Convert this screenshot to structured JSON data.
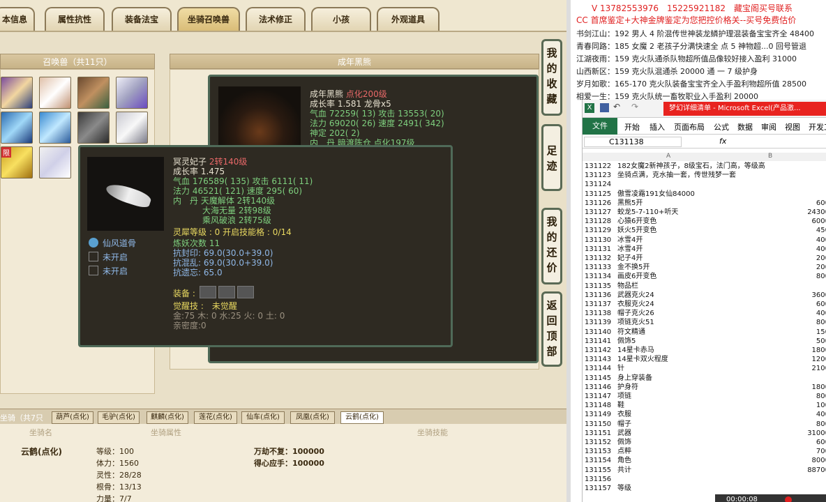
{
  "tabs": [
    {
      "label": "本信息"
    },
    {
      "label": "属性抗性"
    },
    {
      "label": "装备法宝"
    },
    {
      "label": "坐骑召唤兽"
    },
    {
      "label": "法术修正"
    },
    {
      "label": "小孩"
    },
    {
      "label": "外观道具"
    }
  ],
  "summon_panel": {
    "title": "召唤兽（共11只）",
    "badge": "限"
  },
  "adult_panel": {
    "title": "成年黑熊"
  },
  "side_buttons": [
    {
      "label": "我的收藏"
    },
    {
      "label": "足迹"
    },
    {
      "label": "我的还价"
    },
    {
      "label": "返回顶部"
    }
  ],
  "bear_card": {
    "name": "成年黑熊",
    "name_tag": "点化200级",
    "lines": [
      "成长率 1.581 龙骨x5",
      "气血 72259( 13) 攻击 13553( 20)",
      "法力 69020( 26) 速度 2491( 342)",
      "神定 202( 2)",
      "内　丹 暗渡陈仓 点化197级"
    ]
  },
  "pet_card": {
    "name": "冥灵妃子",
    "name_tag": "2转140级",
    "growth": "成长率 1.475",
    "hp": "气血 176589( 135) 攻击 6111( 11)",
    "mp": "法力 46521( 121) 速度 295( 60)",
    "inner1": "内　丹 天魔解体 2转140级",
    "inner2": "大海无量 2转98级",
    "inner3": "乘风破浪 2转75级",
    "soul": "灵犀等级 : 0 开启技能格 : 0/14",
    "refine": "炼妖次数 11",
    "res1": "抗封印: 69.0(30.0+39.0)",
    "res2": "抗混乱: 69.0(30.0+39.0)",
    "res3": "抗遗忘: 65.0",
    "equip": "装备 :",
    "awaken": "觉醒技 :　未觉醒",
    "elements": "金:75 木: 0 水:25 火: 0 土: 0",
    "intimacy": "亲密度:0",
    "skills": [
      {
        "label": "仙风道骨"
      },
      {
        "label": "未开启"
      },
      {
        "label": "未开启"
      }
    ]
  },
  "mount_tabs": {
    "header": "坐骑（共7只",
    "items": [
      {
        "label": "葫芦(点化)"
      },
      {
        "label": "毛驴(点化)"
      },
      {
        "label": "麒麟(点化)"
      },
      {
        "label": "莲花(点化)"
      },
      {
        "label": "仙车(点化)"
      },
      {
        "label": "凤凰(点化)"
      },
      {
        "label": "云鹤(点化)"
      }
    ]
  },
  "mount_info": {
    "col_name": "坐骑名",
    "col_attr": "坐骑属性",
    "col_skill": "坐骑技能",
    "name": "云鹤(点化)",
    "attrs": [
      "等级：100",
      "体力：1560",
      "灵性：28/28",
      "根骨：13/13",
      "力量：7/7"
    ],
    "skills": [
      "万劫不复：100000",
      "得心应手：100000"
    ]
  },
  "promo": [
    {
      "text": "V 13782553976　15225921182　藏宝阁买号联系",
      "red": true
    },
    {
      "text": "CC 首席鉴定+大神金牌鉴定为您把控价格关--买号免费估价",
      "red": true
    },
    {
      "text": "书剑江山：192 男人 4 阶混传世神装龙鳞护理混装备宝宝齐全 48400",
      "red": false
    },
    {
      "text": "青春同路：185 女魔 2 老孩子分满快速全 点 5 神物超...0 回号管退",
      "red": false
    },
    {
      "text": "江湖夜雨：159 克火队通杀队物超所值品像较好接入盈利 31000",
      "red": false
    },
    {
      "text": "山西新区：159 克火队混通杀 20000 通 一 7 级护身",
      "red": false
    },
    {
      "text": "岁月如歌：165-170 克火队装备宝宝齐全入手盈利物超所值 28500",
      "red": false
    },
    {
      "text": "相爱一生：159 克火队统一畜牧职业入手盈利 20000",
      "red": false
    }
  ],
  "excel": {
    "title": "梦幻详细清单 - Microsoft Excel(产品激...",
    "ribbon": [
      "文件",
      "开始",
      "插入",
      "页面布局",
      "公式",
      "数据",
      "审阅",
      "视图",
      "开发工"
    ],
    "cell_ref": "C131138",
    "fx": "fx",
    "col_a": "A",
    "col_b": "B",
    "rows": [
      {
        "n": "131122",
        "a": "182女魔2新神孩子，8级宝石，法门高，等级高",
        "b": ""
      },
      {
        "n": "131123",
        "a": "坐骑点满，克水抽一套，传世残梦一套",
        "b": ""
      },
      {
        "n": "131124",
        "a": "",
        "b": ""
      },
      {
        "n": "131125",
        "a": "傲雪凌霜191女仙84000",
        "b": ""
      },
      {
        "n": "131126",
        "a": "黑熊5开",
        "b": "600"
      },
      {
        "n": "131127",
        "a": "蛟龙5-7-110+听天",
        "b": "24300"
      },
      {
        "n": "131128",
        "a": "心猿6开变色",
        "b": "6000"
      },
      {
        "n": "131129",
        "a": "妖火5开变色",
        "b": "450"
      },
      {
        "n": "131130",
        "a": "冰雪4开",
        "b": "400"
      },
      {
        "n": "131131",
        "a": "冰雪4开",
        "b": "400"
      },
      {
        "n": "131132",
        "a": "妃子4开",
        "b": "200"
      },
      {
        "n": "131133",
        "a": "金不换5开",
        "b": "200"
      },
      {
        "n": "131134",
        "a": "画皮6开变色",
        "b": "800"
      },
      {
        "n": "131135",
        "a": "物品栏",
        "b": ""
      },
      {
        "n": "131136",
        "a": "武器克火24",
        "b": "3600"
      },
      {
        "n": "131137",
        "a": "衣服克火24",
        "b": "600"
      },
      {
        "n": "131138",
        "a": "帽子克火26",
        "b": "400"
      },
      {
        "n": "131139",
        "a": "项链克火51",
        "b": "800"
      },
      {
        "n": "131140",
        "a": "符文精通",
        "b": "150"
      },
      {
        "n": "131141",
        "a": "佩饰5",
        "b": "500"
      },
      {
        "n": "131142",
        "a": "14星卡赤马",
        "b": "1800"
      },
      {
        "n": "131143",
        "a": "14星卡双火程度",
        "b": "1200"
      },
      {
        "n": "131144",
        "a": "针",
        "b": "2100"
      },
      {
        "n": "131145",
        "a": "身上穿装备",
        "b": ""
      },
      {
        "n": "131146",
        "a": "护身符",
        "b": "1800"
      },
      {
        "n": "131147",
        "a": "项链",
        "b": "800"
      },
      {
        "n": "131148",
        "a": "鞋",
        "b": "100"
      },
      {
        "n": "131149",
        "a": "衣服",
        "b": "400"
      },
      {
        "n": "131150",
        "a": "帽子",
        "b": "800"
      },
      {
        "n": "131151",
        "a": "武器",
        "b": "31000"
      },
      {
        "n": "131152",
        "a": "佩饰",
        "b": "600"
      },
      {
        "n": "131153",
        "a": "点粹",
        "b": "700"
      },
      {
        "n": "131154",
        "a": "角色",
        "b": "8000"
      },
      {
        "n": "131155",
        "a": "共计",
        "b": "88700"
      },
      {
        "n": "131156",
        "a": "",
        "b": ""
      },
      {
        "n": "131157",
        "a": "等级",
        "b": ""
      }
    ],
    "timer": "00:00:08"
  },
  "colors": {
    "accent_red": "#e02020",
    "excel_green": "#217346"
  }
}
